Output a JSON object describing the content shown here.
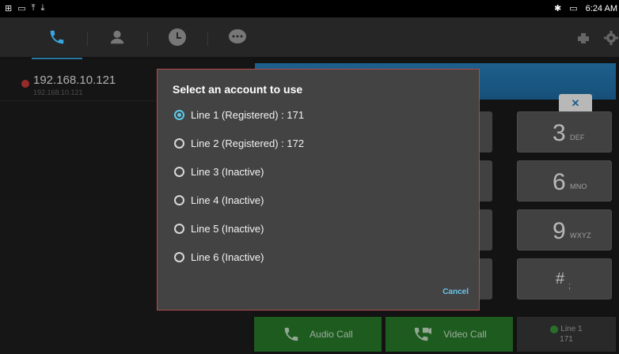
{
  "status_bar": {
    "time": "6:24 AM"
  },
  "history": {
    "title": "192.168.10.121",
    "subtitle": "192.168.10.121"
  },
  "keypad": [
    {
      "big": "3",
      "small": "DEF"
    },
    {
      "big": "6",
      "small": "MNO"
    },
    {
      "big": "9",
      "small": "WXYZ"
    },
    {
      "big": "#",
      "small": ";"
    }
  ],
  "bottom_buttons": {
    "audio_call": "Audio Call",
    "video_call": "Video Call",
    "line_label": "Line 1",
    "line_number": "171"
  },
  "dialog": {
    "title": "Select an account to use",
    "options": [
      {
        "label": "Line 1 (Registered) : 171",
        "selected": true
      },
      {
        "label": "Line 2 (Registered) : 172",
        "selected": false
      },
      {
        "label": "Line 3 (Inactive)",
        "selected": false
      },
      {
        "label": "Line 4 (Inactive)",
        "selected": false
      },
      {
        "label": "Line 5 (Inactive)",
        "selected": false
      },
      {
        "label": "Line 6 (Inactive)",
        "selected": false
      }
    ],
    "cancel_label": "Cancel"
  },
  "colors": {
    "accent": "#3aa6e0",
    "dialog_border": "#b14a4a",
    "call_green": "#2a7e2c",
    "radio_selected": "#5cc8e8"
  },
  "icons": [
    "usb-icon",
    "screenshot-icon",
    "upload-icon",
    "download-icon",
    "bluetooth-icon",
    "network-icon",
    "phone-icon",
    "contacts-icon",
    "history-icon",
    "chat-icon",
    "dnd-icon",
    "settings-icon",
    "backspace-icon",
    "missed-call-icon",
    "video-call-icon"
  ]
}
